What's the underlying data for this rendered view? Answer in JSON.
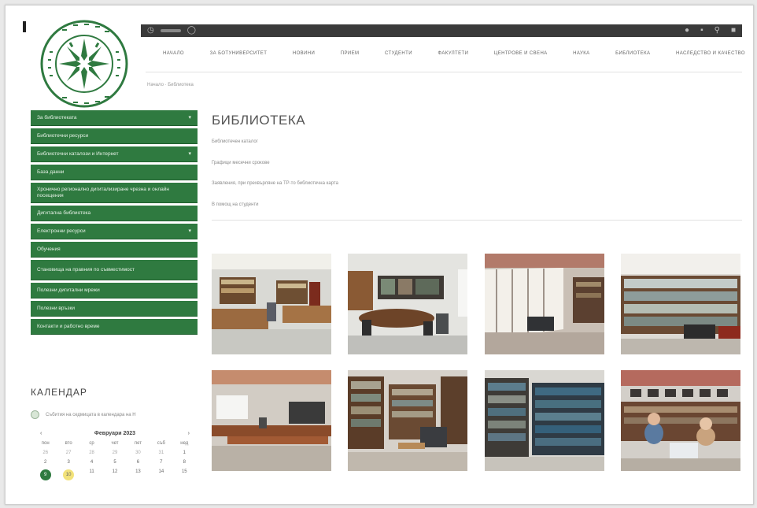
{
  "topbar": {
    "left_icons": [
      "clock-icon",
      "globe-icon"
    ],
    "right_icons": [
      "user-icon",
      "flag-icon",
      "search-icon",
      "menu-icon"
    ]
  },
  "nav": [
    "НАЧАЛО",
    "ЗА БОТУНИВЕРСИТЕТ",
    "НОВИНИ",
    "ПРИЕМ",
    "СТУДЕНТИ",
    "ФАКУЛТЕТИ",
    "ЦЕНТРОВЕ И СВЕНА",
    "НАУКА",
    "БИБЛИОТЕКА",
    "НАСЛЕДСТВО И КАЧЕСТВО"
  ],
  "breadcrumb": "Начало · Библиотека",
  "sidebar": [
    {
      "label": "За библиотеката",
      "caret": true,
      "tall": false
    },
    {
      "label": "Библиотечни ресурси",
      "caret": false,
      "tall": false
    },
    {
      "label": "Библиотечни каталози и Интернет",
      "caret": true,
      "tall": false
    },
    {
      "label": "База данни",
      "caret": false,
      "tall": false
    },
    {
      "label": "Хронично регионално дигитализиране чрезна и онлайн посещения",
      "caret": false,
      "tall": true
    },
    {
      "label": "Дигитална библиотека",
      "caret": false,
      "tall": false
    },
    {
      "label": "Електронни ресурси",
      "caret": true,
      "tall": false
    },
    {
      "label": "Обучения",
      "caret": false,
      "tall": false
    },
    {
      "label": "Становища на правния по съвместимост",
      "caret": false,
      "tall": true
    },
    {
      "label": "Полезни дигитални мрежи",
      "caret": false,
      "tall": false
    },
    {
      "label": "Полезни връзки",
      "caret": false,
      "tall": false
    },
    {
      "label": "Контакти и работно време",
      "caret": false,
      "tall": false
    }
  ],
  "calendar": {
    "title": "КАЛЕНДАР",
    "event_text": "Събития на седмицата в календара на Н",
    "prev": "‹",
    "next": "›",
    "month": "Февруари 2023",
    "day_names": [
      "пон",
      "вто",
      "ср",
      "чет",
      "пет",
      "съб",
      "нед"
    ],
    "rows": [
      [
        "26",
        "27",
        "28",
        "29",
        "30",
        "31",
        "1"
      ],
      [
        "2",
        "3",
        "4",
        "5",
        "6",
        "7",
        "8"
      ],
      [
        "9",
        "10",
        "11",
        "12",
        "13",
        "14",
        "15"
      ]
    ]
  },
  "main": {
    "title": "БИБЛИОТЕКА",
    "links": [
      "Библиотечен каталог",
      "Графици месечни срокове",
      "Заявления, при прехвърляне на ТР-то библиотечна карта",
      "В помощ на студенти"
    ]
  },
  "photos": [
    "library-reading-room-photo",
    "library-study-table-photo",
    "library-window-hall-photo",
    "library-bookshelves-photo",
    "library-lecture-room-photo",
    "library-shelves-armchair-photo",
    "library-stacks-photo",
    "library-staff-desk-photo"
  ],
  "colors": {
    "sidebar_green": "#2f7a40",
    "topbar": "#3a3a3a",
    "highlight_yellow": "#f2e27a"
  }
}
